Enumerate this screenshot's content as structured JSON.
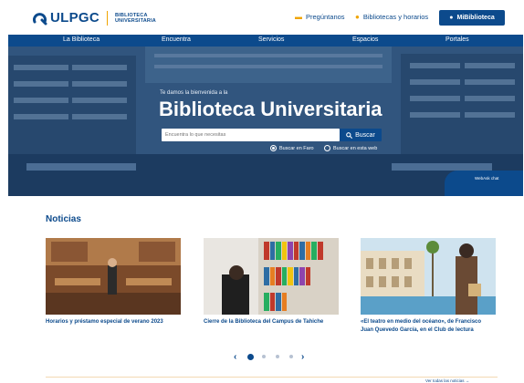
{
  "brand": {
    "name": "ULPGC",
    "sub_line1": "BIBLIOTECA",
    "sub_line2": "UNIVERSITARIA",
    "color": "#0c4a8c",
    "accent": "#f0a400"
  },
  "top_links": [
    {
      "label": "Pregúntanos",
      "icon": "chat-bubble-icon"
    },
    {
      "label": "Bibliotecas y horarios",
      "icon": "map-pin-icon"
    }
  ],
  "account_button": {
    "label": "MiBiblioteca",
    "icon": "user-icon"
  },
  "nav": [
    "La Biblioteca",
    "Encuentra",
    "Servicios",
    "Espacios",
    "Portales"
  ],
  "hero": {
    "welcome": "Te damos la bienvenida a la",
    "title": "Biblioteca Universitaria",
    "search_placeholder": "Encuentra lo que necesitas",
    "search_button": "Buscar",
    "search_icon": "search-icon",
    "radio_options": [
      {
        "label": "Buscar en Faro",
        "selected": true
      },
      {
        "label": "Buscar en esta web",
        "selected": false
      }
    ],
    "chat_label": "WebAsk chat"
  },
  "news": {
    "heading": "Noticias",
    "items": [
      {
        "caption": "Horarios y préstamo especial de verano 2023"
      },
      {
        "caption": "Cierre de la Biblioteca del Campus de Tahiche"
      },
      {
        "caption_line1": "«El teatro en medio del océano», de Francisco",
        "caption_line2": "Juan Quevedo García, en el Club de lectura"
      }
    ],
    "prev": "‹",
    "next": "›",
    "pages": 5,
    "active_page": 1,
    "see_all": "Ver todas las noticias →"
  }
}
